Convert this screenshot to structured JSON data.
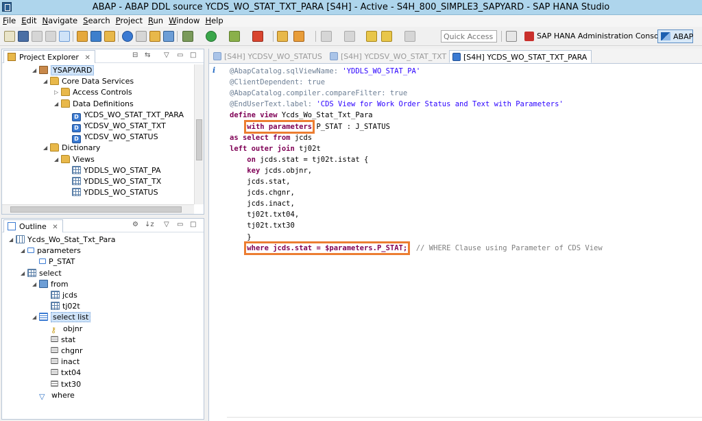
{
  "window": {
    "title": "ABAP - ABAP DDL source YCDS_WO_STAT_TXT_PARA [S4H] - Active - S4H_800_SIMPLE3_SAPYARD - SAP HANA Studio"
  },
  "menu": [
    "File",
    "Edit",
    "Navigate",
    "Search",
    "Project",
    "Run",
    "Window",
    "Help"
  ],
  "toolbar": {
    "quick_access_placeholder": "Quick Access",
    "perspective_hana": "SAP HANA Administration Console",
    "perspective_abap": "ABAP"
  },
  "project_explorer": {
    "tab_label": "Project Explorer",
    "tree": [
      {
        "label": "YSAPYARD",
        "icon": "project-icon",
        "level": 0
      },
      {
        "label": "Core Data Services",
        "icon": "folder-icon",
        "level": 1
      },
      {
        "label": "Access Controls",
        "icon": "folder-icon",
        "level": 2
      },
      {
        "label": "Data Definitions",
        "icon": "folder-icon",
        "level": 2
      },
      {
        "label": "YCDS_WO_STAT_TXT_PARA",
        "icon": "ddl-icon",
        "level": 3
      },
      {
        "label": "YCDSV_WO_STAT_TXT",
        "icon": "ddl-icon",
        "level": 3
      },
      {
        "label": "YCDSV_WO_STATUS",
        "icon": "ddl-icon",
        "level": 3
      },
      {
        "label": "Dictionary",
        "icon": "folder-icon",
        "level": 1
      },
      {
        "label": "Views",
        "icon": "folder-icon",
        "level": 2
      },
      {
        "label": "YDDLS_WO_STAT_PA",
        "icon": "view-icon",
        "level": 3
      },
      {
        "label": "YDDLS_WO_STAT_TX",
        "icon": "view-icon",
        "level": 3
      },
      {
        "label": "YDDLS_WO_STATUS",
        "icon": "view-icon",
        "level": 3
      }
    ]
  },
  "outline": {
    "tab_label": "Outline",
    "tree": [
      {
        "label": "Ycds_Wo_Stat_Txt_Para",
        "icon": "cds-view-icon",
        "level": 0
      },
      {
        "label": "parameters",
        "icon": "parameters-icon",
        "level": 1
      },
      {
        "label": "P_STAT",
        "icon": "parameter-icon",
        "level": 2
      },
      {
        "label": "select",
        "icon": "select-icon",
        "level": 1
      },
      {
        "label": "from",
        "icon": "from-icon",
        "level": 2
      },
      {
        "label": "jcds",
        "icon": "table-icon",
        "level": 3
      },
      {
        "label": "tj02t",
        "icon": "table-icon",
        "level": 3
      },
      {
        "label": "select list",
        "icon": "select-list-icon",
        "level": 2
      },
      {
        "label": "objnr",
        "icon": "key-icon",
        "level": 3
      },
      {
        "label": "stat",
        "icon": "field-icon",
        "level": 3
      },
      {
        "label": "chgnr",
        "icon": "field-icon",
        "level": 3
      },
      {
        "label": "inact",
        "icon": "field-icon",
        "level": 3
      },
      {
        "label": "txt04",
        "icon": "field-icon",
        "level": 3
      },
      {
        "label": "txt30",
        "icon": "field-icon",
        "level": 3
      },
      {
        "label": "where",
        "icon": "filter-icon",
        "level": 2
      }
    ]
  },
  "editor": {
    "tabs": [
      {
        "label": "[S4H] YCDSV_WO_STATUS",
        "active": false
      },
      {
        "label": "[S4H] YCDSV_WO_STAT_TXT",
        "active": false
      },
      {
        "label": "[S4H] YCDS_WO_STAT_TXT_PARA",
        "active": true
      }
    ],
    "lines": [
      [
        {
          "t": "@AbapCatalog.sqlViewName: ",
          "c": "anno"
        },
        {
          "t": "'YDDLS_WO_STAT_PA'",
          "c": "str"
        }
      ],
      [
        {
          "t": "@ClientDependent: true",
          "c": "anno"
        }
      ],
      [
        {
          "t": "@AbapCatalog.compiler.compareFilter: true",
          "c": "anno"
        }
      ],
      [
        {
          "t": "@EndUserText.label: ",
          "c": "anno"
        },
        {
          "t": "'CDS View for Work Order Status and Text with Parameters'",
          "c": "str"
        }
      ],
      [
        {
          "t": "define view ",
          "c": "kw"
        },
        {
          "t": "Ycds_Wo_Stat_Txt_Para",
          "c": "txt"
        }
      ],
      [
        {
          "t": "    ",
          "c": "txt"
        },
        {
          "t": "with parameters",
          "c": "kw",
          "hl": true
        },
        {
          "t": " P_STAT : J_STATUS",
          "c": "txt"
        }
      ],
      [
        {
          "t": "as select from ",
          "c": "kw"
        },
        {
          "t": "jcds",
          "c": "txt"
        }
      ],
      [
        {
          "t": "left outer join ",
          "c": "kw"
        },
        {
          "t": "tj02t",
          "c": "txt"
        }
      ],
      [
        {
          "t": "    ",
          "c": "txt"
        },
        {
          "t": "on ",
          "c": "kw"
        },
        {
          "t": "jcds.stat = tj02t.istat {",
          "c": "txt"
        }
      ],
      [
        {
          "t": "    ",
          "c": "txt"
        },
        {
          "t": "key ",
          "c": "kw"
        },
        {
          "t": "jcds.objnr,",
          "c": "txt"
        }
      ],
      [
        {
          "t": "    jcds.stat,",
          "c": "txt"
        }
      ],
      [
        {
          "t": "    jcds.chgnr,",
          "c": "txt"
        }
      ],
      [
        {
          "t": "    jcds.inact,",
          "c": "txt"
        }
      ],
      [
        {
          "t": "    tj02t.txt04,",
          "c": "txt"
        }
      ],
      [
        {
          "t": "    tj02t.txt30",
          "c": "txt"
        }
      ],
      [
        {
          "t": "    }",
          "c": "txt"
        }
      ],
      [
        {
          "t": "    ",
          "c": "txt"
        },
        {
          "t": "where jcds.stat = $parameters.P_STAT;",
          "c": "kw-mix",
          "hl": true
        },
        {
          "t": "  // WHERE Clause using Parameter of CDS View",
          "c": "cmt"
        }
      ]
    ]
  },
  "colors": {
    "highlight": "#ec7d31",
    "keyword": "#7f0055",
    "string": "#2a00ff",
    "annotation": "#6d7f95"
  }
}
